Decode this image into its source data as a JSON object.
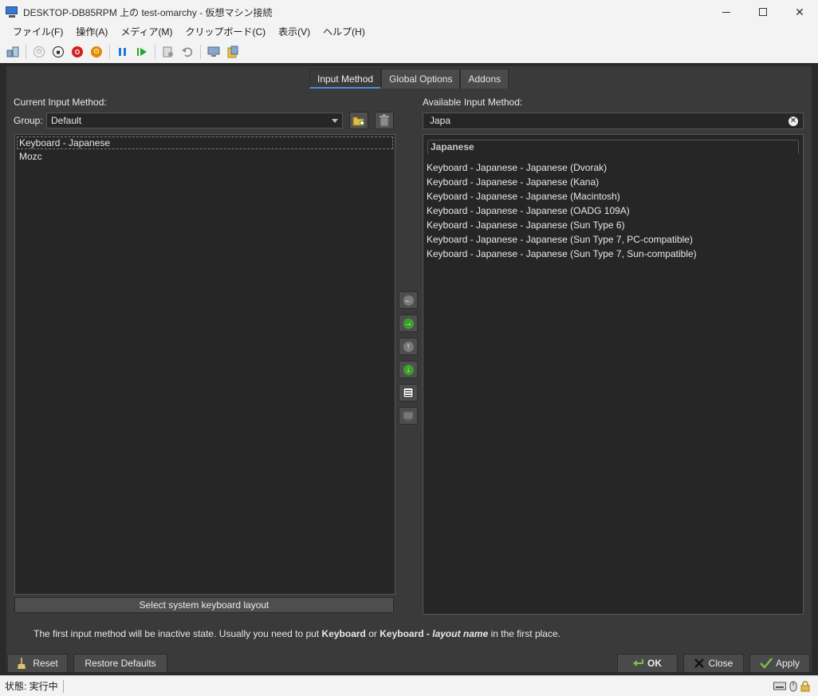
{
  "window": {
    "title": "DESKTOP-DB85RPM 上の test-omarchy  - 仮想マシン接続",
    "menus": [
      "ファイル(F)",
      "操作(A)",
      "メディア(M)",
      "クリップボード(C)",
      "表示(V)",
      "ヘルプ(H)"
    ]
  },
  "tabs": [
    {
      "label": "Input Method",
      "active": true
    },
    {
      "label": "Global Options",
      "active": false
    },
    {
      "label": "Addons",
      "active": false
    }
  ],
  "left": {
    "heading": "Current Input Method:",
    "group_label": "Group:",
    "group_value": "Default",
    "items": [
      "Keyboard - Japanese",
      "Mozc"
    ],
    "select_layout_button": "Select system keyboard layout"
  },
  "right": {
    "heading": "Available Input Method:",
    "search_value": "Japa",
    "group_header": "Japanese",
    "items": [
      "Keyboard - Japanese - Japanese (Dvorak)",
      "Keyboard - Japanese - Japanese (Kana)",
      "Keyboard - Japanese - Japanese (Macintosh)",
      "Keyboard - Japanese - Japanese (OADG 109A)",
      "Keyboard - Japanese - Japanese (Sun Type 6)",
      "Keyboard - Japanese - Japanese (Sun Type 7, PC-compatible)",
      "Keyboard - Japanese - Japanese (Sun Type 7, Sun-compatible)"
    ]
  },
  "hint": {
    "p1": "The first input method will be inactive state. Usually you need to put ",
    "b1": "Keyboard",
    "p2": " or ",
    "b2a": "Keyboard - ",
    "b2b": "layout name",
    "p3": " in the first place."
  },
  "buttons": {
    "reset": "Reset",
    "restore_defaults": "Restore Defaults",
    "ok": "OK",
    "close": "Close",
    "apply": "Apply"
  },
  "status": {
    "text": "状態: 実行中"
  },
  "colors": {
    "accent": "#4c8fd6",
    "panel": "#3a3a3a",
    "list_bg": "#262626",
    "green_arrow": "#3f9e2e"
  }
}
